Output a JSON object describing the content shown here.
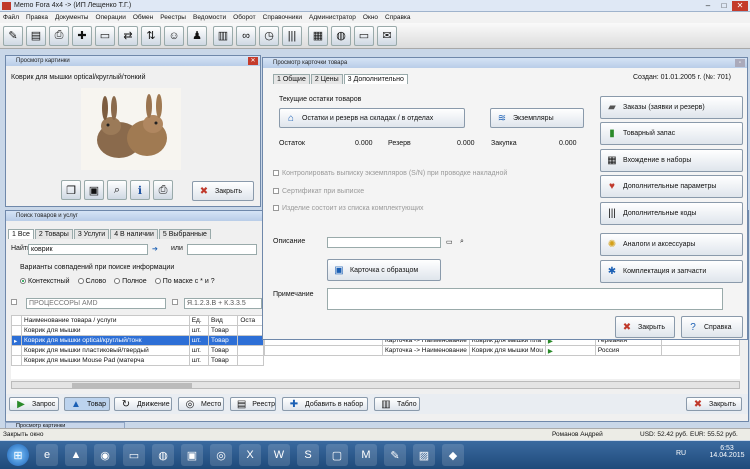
{
  "title": "Memo Fora 4x4 -> (ИП Лещенко Т.Г.)",
  "menu": [
    "Файл",
    "Правка",
    "Документы",
    "Операции",
    "Обмен",
    "Реестры",
    "Ведомости",
    "Оборот",
    "Справочники",
    "Администратор",
    "Окно",
    "Справка"
  ],
  "toolbar_icons": [
    "edit-icon",
    "card-icon",
    "printer-icon",
    "document-add-icon",
    "document-remove-icon",
    "exchange-icon",
    "transfer-icon",
    "user-icon",
    "users-icon",
    "columns-icon",
    "binoculars-icon",
    "clock-icon",
    "barcode-icon",
    "calculator-icon",
    "globe-icon",
    "chat-icon",
    "mail-icon"
  ],
  "preview": {
    "title": "Просмотр картинки",
    "caption": "Коврик для мышки  optical/круглый/тонкий",
    "close": "Закрыть"
  },
  "search": {
    "title": "Поиск товаров и услуг",
    "tabs": [
      "1 Все",
      "2 Товары",
      "3 Услуги",
      "4 В наличии",
      "5 Выбранные"
    ],
    "find_label": "Найти",
    "find_value": "коврик",
    "or_label": "или",
    "variants_label": "Варианты совпадений при поиске информации",
    "variants": [
      "Контекстный",
      "Слово",
      "Полное",
      "По маске с * и ?"
    ],
    "group": "ПРОЦЕССОРЫ AMD",
    "mask": "Я.1.2.3.В + К.3.3.5",
    "columns": [
      "Наименование товара / услуги",
      "Ед.",
      "Вид",
      "Оста"
    ],
    "rows": [
      {
        "name": "Коврик для мышки",
        "unit": "шт.",
        "kind": "Товар"
      },
      {
        "name": "Коврик для мышки  optical/круглый/тонк",
        "unit": "шт.",
        "kind": "Товар"
      },
      {
        "name": "Коврик для мышки  пластиковый/твердый",
        "unit": "шт.",
        "kind": "Товар"
      },
      {
        "name": "Коврик для мышки Mouse Pad  (матерча",
        "unit": "шт.",
        "kind": "Товар"
      }
    ]
  },
  "right_rows": [
    {
      "a": "Карточка -> Наименование",
      "b": "Коврик для мышки  пла",
      "country": "Германия"
    },
    {
      "a": "Карточка -> Наименование",
      "b": "Коврик для мышки Mou",
      "country": "Россия"
    }
  ],
  "card": {
    "title": "Просмотр карточки товара",
    "tabs": [
      "1 Общие",
      "2 Цены",
      "3 Дополнительно"
    ],
    "created": "Создан: 01.01.2005 г. (№: 701)",
    "stock_title": "Текущие остатки товаров",
    "stock_btn": "Остатки и резерв на складах / в отделах",
    "copies_btn": "Экземпляры",
    "remainder_label": "Остаток",
    "remainder": "0.000",
    "reserve_label": "Резерв",
    "reserve": "0.000",
    "purchase_label": "Закупка",
    "purchase": "0.000",
    "checks": [
      "Контролировать выписку экземпляров (S/N) при проводке накладной",
      "Сертификат при выписке",
      "Изделие состоит из списка комплектующих"
    ],
    "desc_label": "Описание",
    "card_img_btn": "Карточка с образцом",
    "note_label": "Примечание",
    "side": [
      "Заказы (заявки и резерв)",
      "Товарный запас",
      "Вхождение в наборы",
      "Дополнительные параметры",
      "Дополнительные коды",
      "Аналоги и аксессуары",
      "Комплектация и запчасти"
    ],
    "close": "Закрыть",
    "help": "Справка"
  },
  "bottom": {
    "buttons": [
      "Запрос",
      "Товар",
      "Движение",
      "Место",
      "Реестр",
      "Добавить в набор",
      "Табло"
    ],
    "close": "Закрыть"
  },
  "tasktab": "Просмотр картинки",
  "status": {
    "left": "Закрыть окно",
    "user": "Романов Андрей",
    "usd": "USD: 52.42 руб.",
    "eur": "EUR: 55.52 руб."
  },
  "clock": {
    "time": "6:53",
    "date": "14.04.2015",
    "lang": "RU"
  }
}
